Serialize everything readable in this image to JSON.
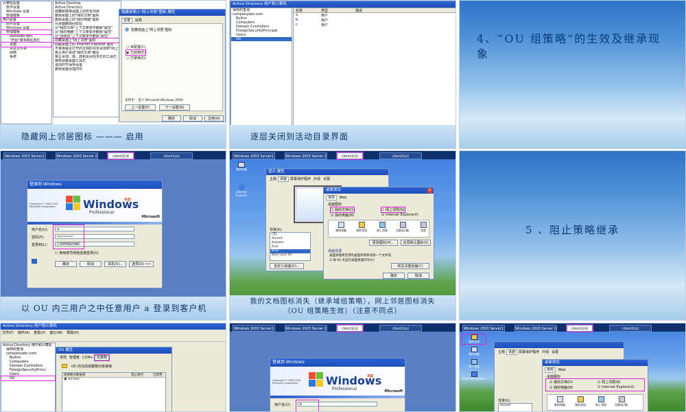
{
  "slides": {
    "s1": {
      "tree": [
        "计算机配置",
        "软件设置",
        "Windows 设置",
        "管理模板",
        "用户配置",
        "软件设置",
        "Windows 设置",
        "管理模板",
        "Windows 组件",
        "\"开始\"菜单和任务栏",
        "桌面",
        "共享文件夹",
        "网络",
        "系统"
      ],
      "list": [
        "Active Desktop",
        "Active Directory",
        "隐藏和禁用桌面上的所有项目",
        "删除桌面上的\"我的文档\"图标",
        "删除桌面上的\"我的电脑\"图标",
        "从桌面删除回收站",
        "从\"我的文档\"上下文菜单中删除\"属性\"",
        "从\"我的电脑\"上下文菜单中删除\"属性\"",
        "从\"回收站\"上下文菜单中删除\"属性\"",
        "隐藏桌面上\"网上邻居\"图标",
        "隐藏桌面上的 Internet Explorer 图标",
        "不要将最近打开的文档的共享添加到\"网上邻居\"",
        "禁止用户更改\"我的文档\"路径",
        "禁止添加、拖、放和关闭任务栏的工具栏",
        "禁用调整桌面工具栏",
        "退出时不保存设置",
        "删除桌面清理向导"
      ],
      "dialog_title": "隐藏桌面上\"网上邻居\"图标 属性",
      "dialog_tabs": [
        "设置",
        "说明"
      ],
      "dialog_name": "隐藏桌面上\"网上邻居\"图标",
      "radios": [
        "未配置(C)",
        "已启用(E)",
        "已禁用(D)"
      ],
      "support": "支持于：  至少 Microsoft Windows 2000",
      "nav": [
        "上一设置(P)",
        "下一设置(N)"
      ],
      "ok": [
        "确定",
        "取消",
        "应用(A)"
      ],
      "caption": "隐藏网上邻居图标 ——— 启用"
    },
    "s2": {
      "title": "Active Directory 用户和计算机",
      "tree": [
        "保存的查询",
        "companyabc.com",
        "Builtin",
        "Computers",
        "Domain Controllers",
        "ForeignSecurityPrincipal",
        "Users",
        "OU"
      ],
      "header": [
        "名称",
        "类型",
        "描述"
      ],
      "rows": [
        [
          "a",
          "用户"
        ],
        [
          "b",
          "用户"
        ],
        [
          "c",
          "用户"
        ]
      ],
      "caption": "逐层关闭到活动目录界面"
    },
    "s3": {
      "heading": "4、“OU 组策略”的生效及继承现象"
    },
    "s4": {
      "tabs": [
        "Windows 2003 Server1",
        "Windows 2003 Server 2",
        "client1(d)",
        "client1(e)"
      ],
      "login_title": "登录到 Windows",
      "copyright": "Copyright © 1985-2001\nMicrosoft Corporation",
      "brand": "Windows",
      "brand_xp": "xp",
      "brand_sub": "Professional",
      "ms": "Microsoft",
      "labels": [
        "用户名(U):",
        "密码(P):",
        "登录到(L):"
      ],
      "values": [
        "a",
        "••••••••",
        "COMPANYABC"
      ],
      "dialup": "使用拨号网络连接登录(D)",
      "buttons": [
        "确定",
        "取消",
        "关机(S)...",
        "选项(O) <<"
      ],
      "caption": "以 OU 内三用户之中任意用户 a 登录到客户机"
    },
    "s5": {
      "tabs": [
        "Windows 2003 Server1",
        "Windows 2003 Server 2",
        "client1(d)",
        "client1(e)"
      ],
      "desk_icons": [
        "我的电脑",
        "Internet Explorer"
      ],
      "disp_title": "显示 属性",
      "disp_tabs": [
        "主题",
        "桌面",
        "屏幕保护程序",
        "外观",
        "设置"
      ],
      "bg_label": "背景(K):",
      "bg_items": [
        "(无)",
        "Ascent",
        "Autumn",
        "Azul",
        "Bliss",
        "Blue Lace 16"
      ],
      "custom_btn": "自定义桌面(D)...",
      "item_title": "桌面项目",
      "item_tabs": [
        "常规",
        "Web"
      ],
      "icons_group": "桌面图标",
      "checks": [
        "我的文档(D)",
        "网上邻居(N)",
        "我的电脑(M)",
        "Internet Explorer(I)"
      ],
      "icon_names": [
        "我的电脑",
        "我的文档",
        "网上邻居",
        "回收站(满)",
        "回收"
      ],
      "change_btns": [
        "更改图标(H)...",
        "还原默认图标(S)"
      ],
      "cleanup_title": "桌面清理",
      "cleanup_text": "桌面清理将无用的桌面项目移动到一个文件夹。",
      "cleanup_check": "每 60 天运行桌面清理向导(U)",
      "cleanup_btn": "现在清理桌面(C)",
      "ok": [
        "确定",
        "取消"
      ],
      "caption": "我的文档图标消失（继承域组策略），网上邻居图标消失（OU 组策略生效）（注意不同点）"
    },
    "s6": {
      "heading": "5 、阻止策略继承"
    },
    "s7": {
      "title": "Active Directory 用户和计算机",
      "menu": [
        "文件(F)",
        "操作(A)",
        "查看(V)",
        "窗口(W)",
        "帮助(H)"
      ],
      "tree": [
        "Active Directory 用户和计算机",
        "保存的查询",
        "companyabc.com",
        "Builtin",
        "Computers",
        "Domain Controllers",
        "ForeignSecurityPrinci",
        "Users",
        "OU"
      ],
      "dlg_title": "OU 属性",
      "dlg_tabs": [
        "常规",
        "管理者",
        "COM+",
        "组策略"
      ],
      "dlg_text": "OU 的当前组策略对象链接",
      "cols": [
        "组策略对象链接",
        "禁止替代",
        "已禁用"
      ],
      "row": "OU test"
    },
    "s8": {
      "tabs": [
        "Windows 2003 Server1",
        "Windows 2003 Server 2",
        "client1(d)",
        "client1(e)"
      ],
      "login_title": "登录到 Windows",
      "copyright": "Copyright © 1985-2001\nMicrosoft Corporation",
      "brand": "Windows",
      "brand_xp": "xp",
      "brand_sub": "Professional",
      "ms": "Microsoft",
      "label": "用户名(U):",
      "value": "b"
    },
    "s9": {
      "tabs": [
        "Windows 2003 Server1",
        "Windows 2003 Server 2",
        "client1(d)",
        "client1(e)"
      ],
      "desk_icons": [
        "我的文档",
        "我的电脑",
        "网上邻居",
        "Internet Explorer"
      ],
      "disp_tabs": [
        "主题",
        "桌面",
        "屏幕保护程序",
        "外观",
        "设置"
      ],
      "item_title": "桌面项目",
      "item_tabs": [
        "常规",
        "Web"
      ],
      "icons_group": "桌面图标",
      "checks": [
        "我的文档(D)",
        "网上邻居(N)",
        "我的电脑(M)",
        "Internet Explorer(I)"
      ],
      "bg_label": "背景(K):",
      "bg_item": "Ascent",
      "icon_names": [
        "我的电脑",
        "我的文档",
        "网上邻居",
        "回收站(满)"
      ]
    }
  }
}
